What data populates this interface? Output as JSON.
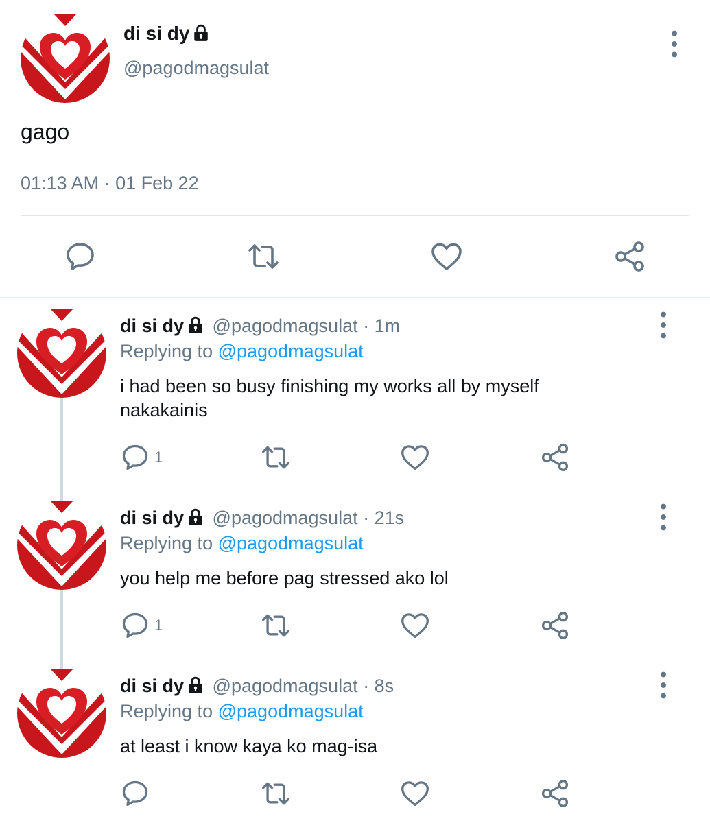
{
  "main_tweet": {
    "display_name": "di si dy",
    "handle": "@pagodmagsulat",
    "text": "gago",
    "timestamp": "01:13 AM · 01 Feb 22",
    "icons": {
      "lock": "lock-icon",
      "more": "more-vertical-icon",
      "reply": "reply-icon",
      "retweet": "retweet-icon",
      "like": "heart-icon",
      "share": "share-icon"
    }
  },
  "replies": [
    {
      "display_name": "di si dy",
      "handle_time": "@pagodmagsulat · 1m",
      "replying_prefix": "Replying to",
      "replying_to": "@pagodmagsulat",
      "text_line1": "i had been so busy finishing my works all by myself",
      "text_line2": "nakakainis",
      "reply_count": "1"
    },
    {
      "display_name": "di si dy",
      "handle_time": "@pagodmagsulat · 21s",
      "replying_prefix": "Replying to",
      "replying_to": "@pagodmagsulat",
      "text_line1": "you help me before pag stressed ako lol",
      "reply_count": "1"
    },
    {
      "display_name": "di si dy",
      "handle_time": "@pagodmagsulat · 8s",
      "replying_prefix": "Replying to",
      "replying_to": "@pagodmagsulat",
      "text_line1": "at least i know kaya ko mag-isa"
    }
  ],
  "colors": {
    "link": "#1d9bf0",
    "muted": "#657786",
    "avatar_red": "#c8161d",
    "divider": "#e1e8ed"
  }
}
